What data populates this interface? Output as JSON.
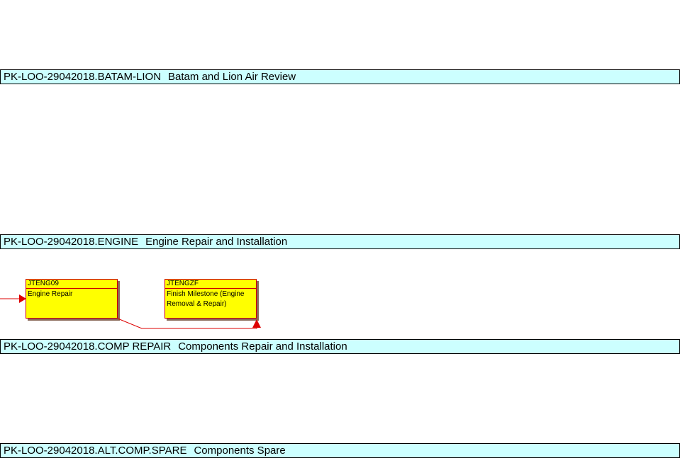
{
  "bands": [
    {
      "code": "PK-LOO-29042018.BATAM-LION",
      "title": "Batam and Lion Air Review"
    },
    {
      "code": "PK-LOO-29042018.ENGINE",
      "title": "Engine Repair and Installation"
    },
    {
      "code": "PK-LOO-29042018.COMP REPAIR",
      "title": "Components Repair and Installation"
    },
    {
      "code": "PK-LOO-29042018.ALT.COMP.SPARE",
      "title": "Components Spare"
    }
  ],
  "tasks": [
    {
      "id": "JTENG09",
      "name": "Engine Repair"
    },
    {
      "id": "JTENGZF",
      "name": "Finish Milestone (Engine Removal & Repair)"
    }
  ],
  "colors": {
    "band_fill": "#ccffff",
    "task_fill": "#ffff00",
    "task_border": "#cc0000",
    "link": "#dd0000"
  }
}
